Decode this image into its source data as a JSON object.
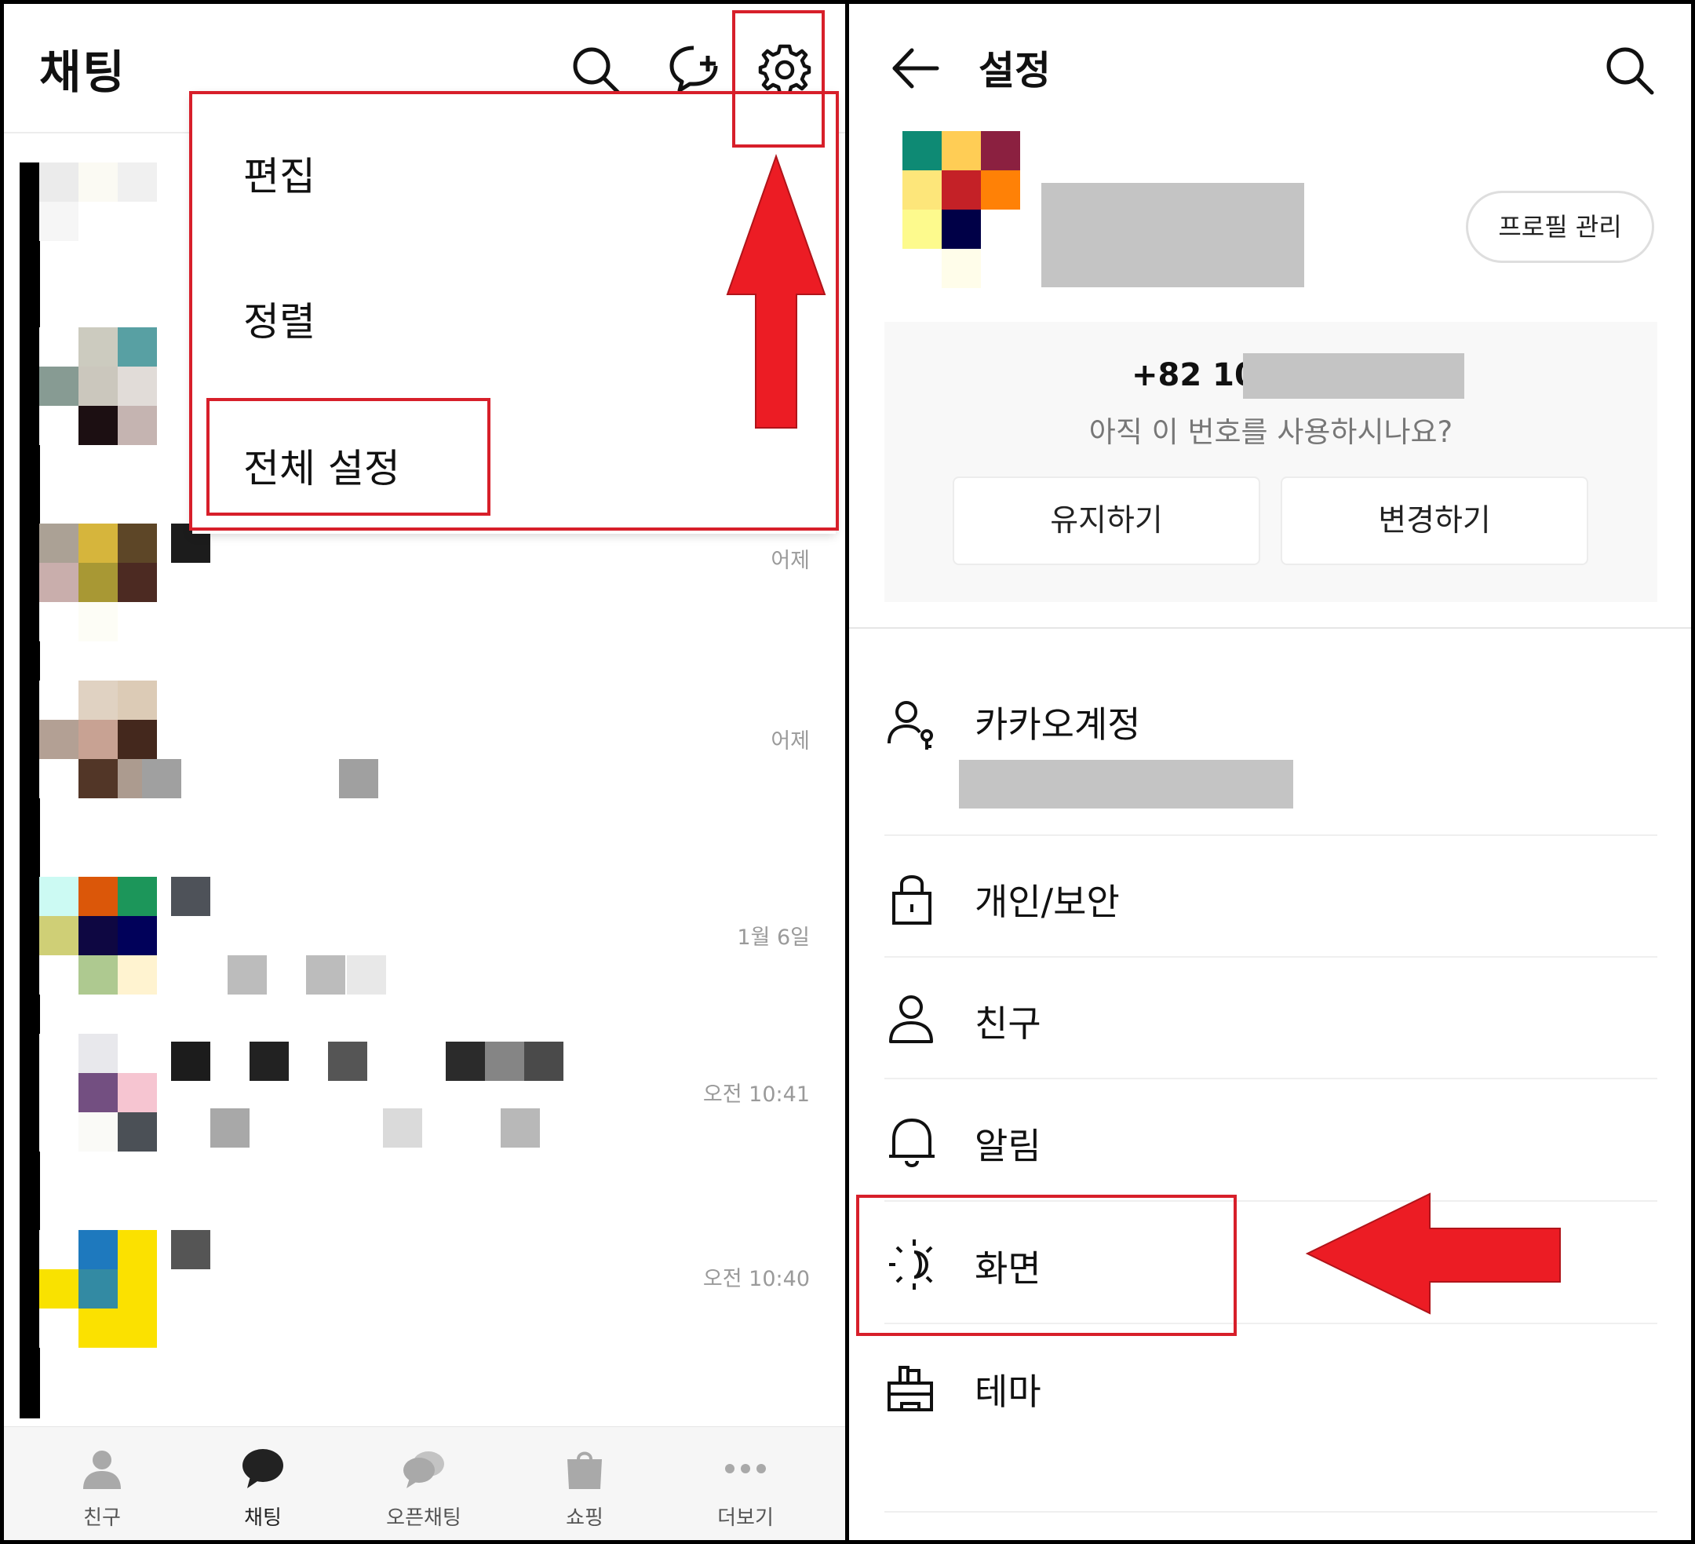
{
  "left": {
    "title": "채팅",
    "header_icons": [
      "search-icon",
      "new-chat-icon",
      "settings-gear-icon"
    ],
    "menu": {
      "items": [
        "편집",
        "정렬",
        "전체 설정"
      ],
      "highlighted": "전체 설정"
    },
    "chats": [
      {
        "time": "어제"
      },
      {
        "time": "어제"
      },
      {
        "time": "1월 6일"
      },
      {
        "time": "오전 10:41"
      },
      {
        "time": "오전 10:40"
      }
    ],
    "nav": [
      {
        "label": "친구",
        "icon": "person-icon"
      },
      {
        "label": "채팅",
        "icon": "chat-bubble-icon"
      },
      {
        "label": "오픈채팅",
        "icon": "open-chat-icon"
      },
      {
        "label": "쇼핑",
        "icon": "shopping-bag-icon"
      },
      {
        "label": "더보기",
        "icon": "more-dots-icon"
      }
    ]
  },
  "right": {
    "title": "설정",
    "profile_button": "프로필 관리",
    "phone": {
      "prefix": "+82 10-",
      "question": "아직 이 번호를 사용하시나요?",
      "keep": "유지하기",
      "change": "변경하기"
    },
    "settings": [
      {
        "label": "카카오계정",
        "icon": "account-icon"
      },
      {
        "label": "개인/보안",
        "icon": "lock-icon"
      },
      {
        "label": "친구",
        "icon": "friend-icon"
      },
      {
        "label": "알림",
        "icon": "bell-icon"
      },
      {
        "label": "화면",
        "icon": "display-brightness-icon"
      },
      {
        "label": "테마",
        "icon": "theme-brush-icon"
      }
    ],
    "highlighted": "화면"
  },
  "colors": {
    "annotation_red": "#d71f2a",
    "arrow_red": "#ec1c24",
    "masked_gray": "#c4c4c4"
  }
}
